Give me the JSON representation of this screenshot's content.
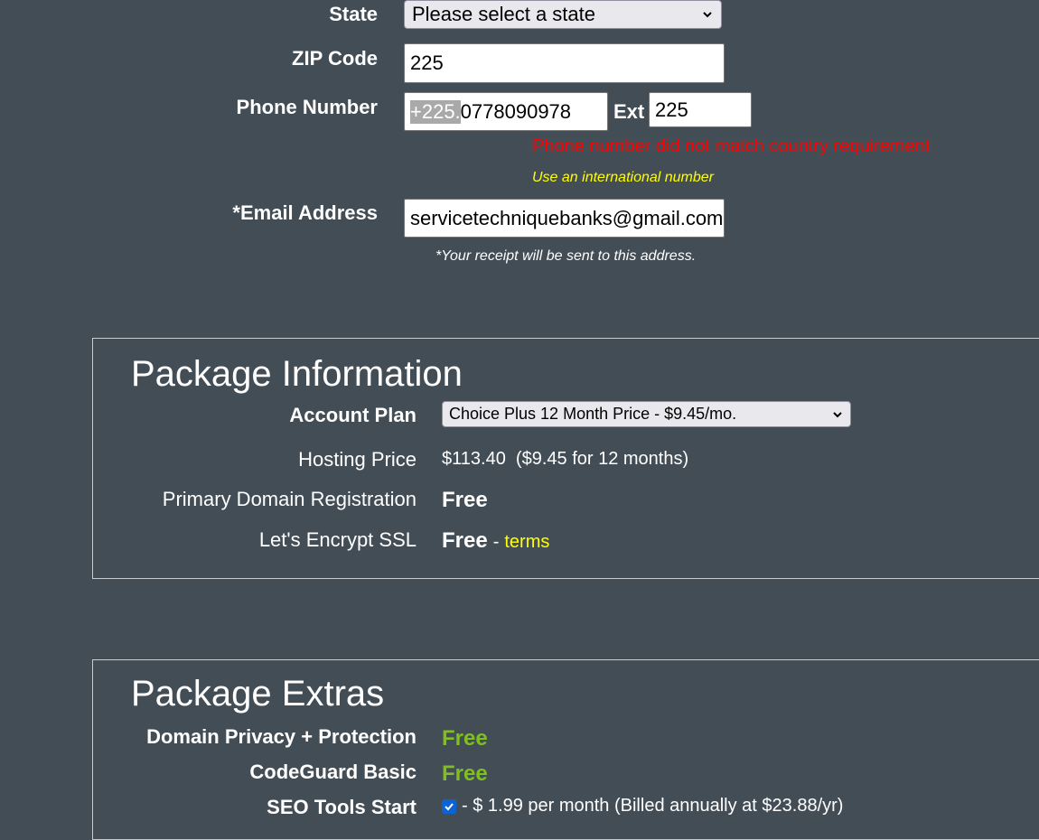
{
  "billing": {
    "state_label": "State",
    "state_selected": "Please select a state",
    "zip_label": "ZIP Code",
    "zip_value": "225",
    "phone_label": "Phone Number",
    "phone_prefix": "+225.",
    "phone_number": "0778090978",
    "ext_label": "Ext",
    "ext_value": "225",
    "phone_error": "Phone number did not match country requirement",
    "phone_hint": "Use an international number",
    "email_label": "*Email Address",
    "email_value": "servicetechniquebanks@gmail.com",
    "email_note": "*Your receipt will be sent to this address."
  },
  "package_info": {
    "title": "Package Information",
    "account_plan_label": "Account Plan",
    "account_plan_selected": "Choice Plus 12 Month Price - $9.45/mo.",
    "hosting_price_label": "Hosting Price",
    "hosting_price_value": "$113.40  ($9.45 for 12 months)",
    "domain_reg_label": "Primary Domain Registration",
    "domain_reg_value": "Free",
    "ssl_label": "Let's Encrypt SSL",
    "ssl_value": "Free",
    "ssl_separator": "-",
    "ssl_terms_link": "terms"
  },
  "package_extras": {
    "title": "Package Extras",
    "domain_privacy_label": "Domain Privacy + Protection",
    "domain_privacy_value": "Free",
    "codeguard_label": "CodeGuard Basic",
    "codeguard_value": "Free",
    "seo_label": "SEO Tools Start",
    "seo_checked": true,
    "seo_text": "- $ 1.99 per month (Billed annually at $23.88/yr)"
  },
  "colors": {
    "background": "#434d55",
    "error": "#ff0000",
    "hint": "#ffff00",
    "free_green": "#7fbf1f",
    "checkbox_blue": "#0a64d8"
  }
}
